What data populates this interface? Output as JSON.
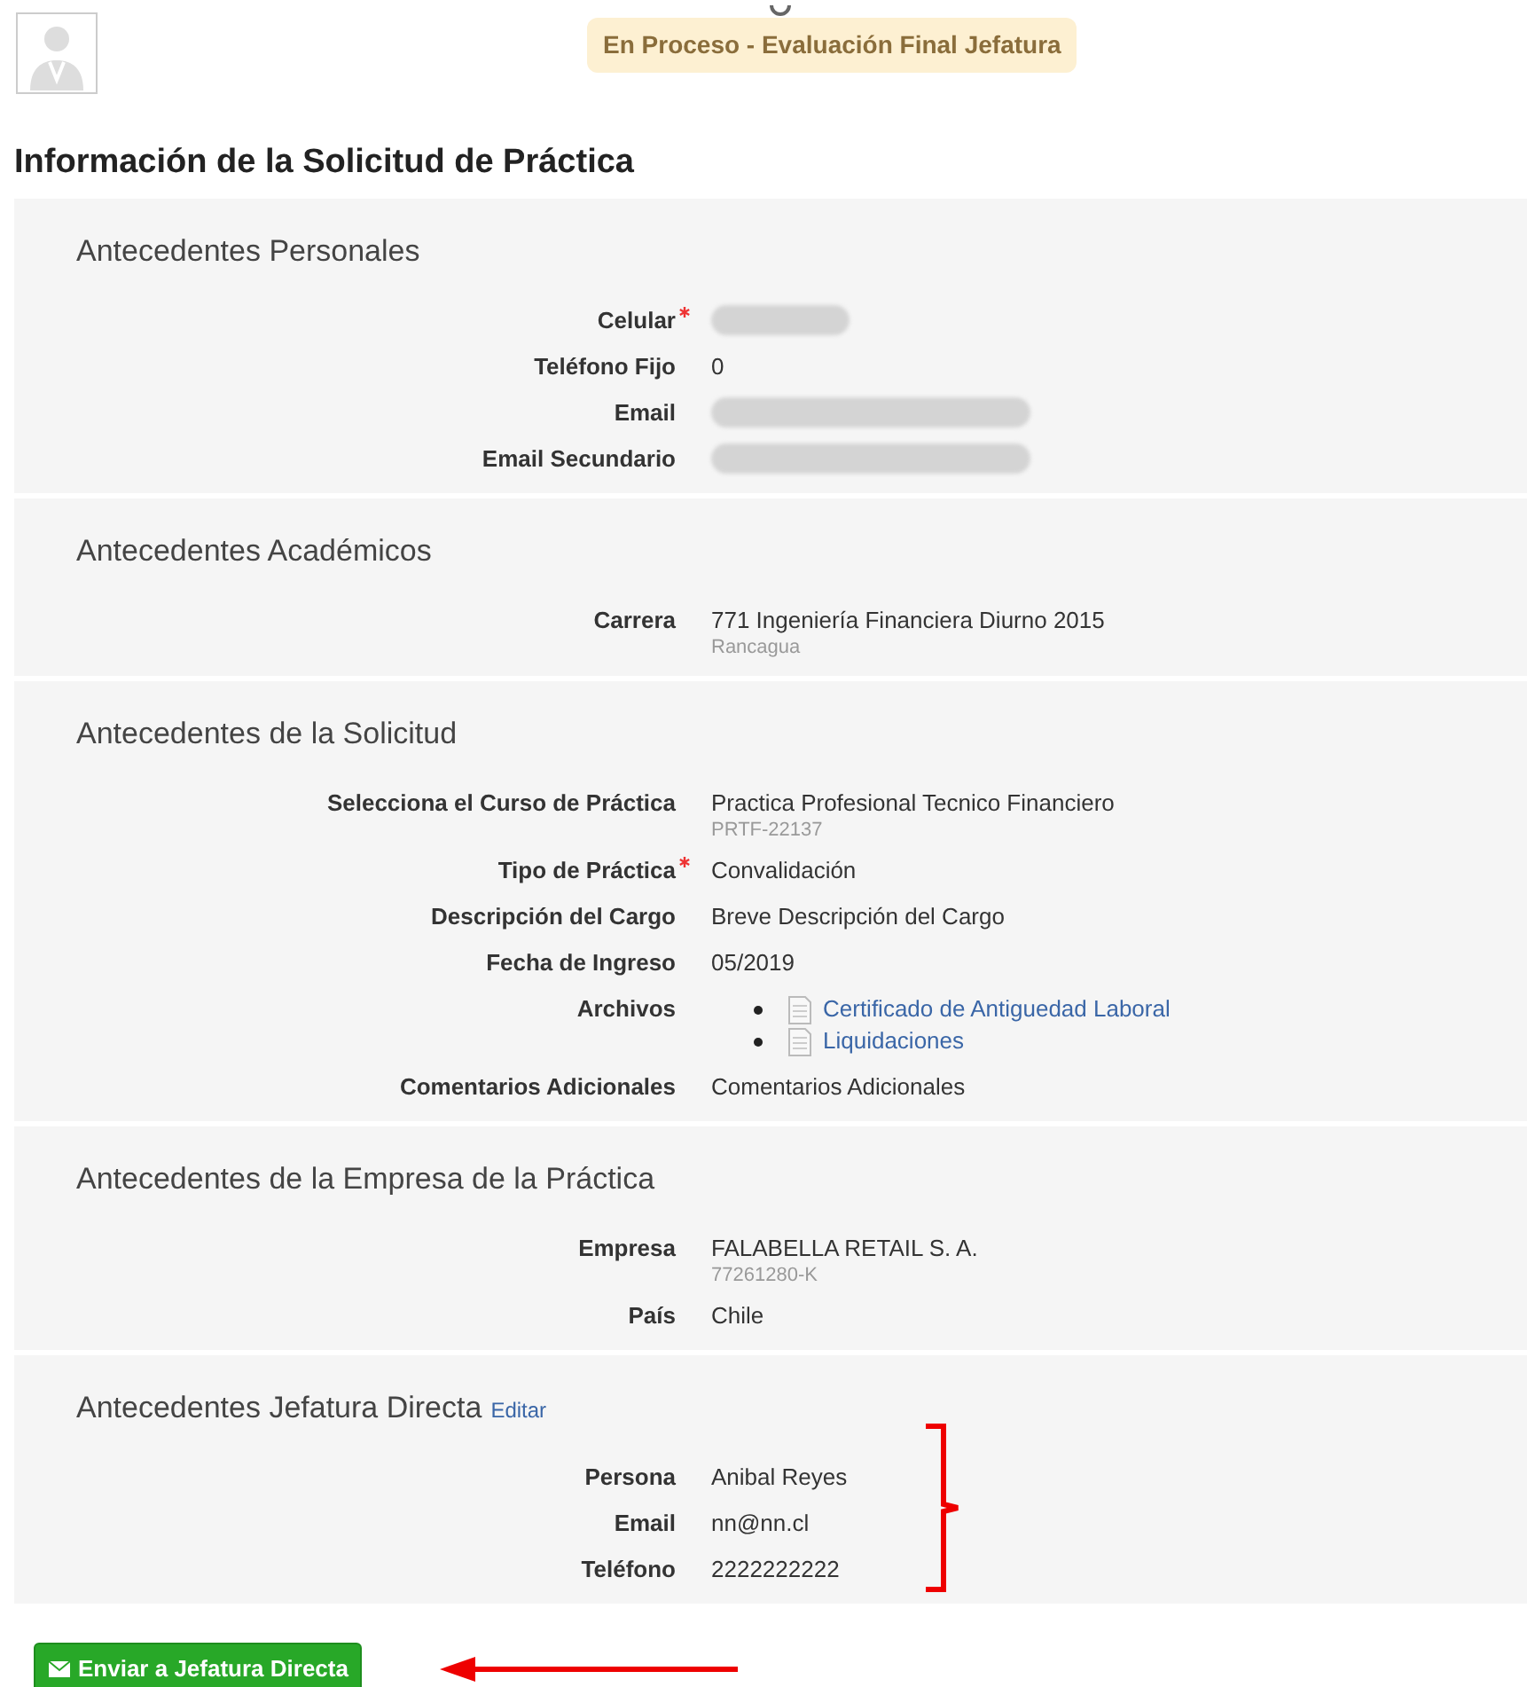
{
  "status_badge": "En Proceso - Evaluación Final Jefatura",
  "title": "Información de la Solicitud de Práctica",
  "sections": [
    {
      "title": "Antecedentes Personales",
      "fields": [
        {
          "kind": "redacted",
          "label": "Celular",
          "required": true
        },
        {
          "kind": "text",
          "label": "Teléfono Fijo",
          "required": false,
          "value": "0"
        },
        {
          "kind": "redacted",
          "label": "Email",
          "required": false
        },
        {
          "kind": "redacted",
          "label": "Email Secundario",
          "required": false
        }
      ]
    },
    {
      "title": "Antecedentes Académicos",
      "fields": [
        {
          "kind": "text",
          "label": "Carrera",
          "required": false,
          "value": "771 Ingeniería Financiera Diurno 2015",
          "sub": "Rancagua"
        }
      ]
    },
    {
      "title": "Antecedentes de la Solicitud",
      "fields": [
        {
          "kind": "text",
          "label": "Selecciona el Curso de Práctica",
          "required": false,
          "value": "Practica Profesional Tecnico Financiero",
          "sub": "PRTF-22137"
        },
        {
          "kind": "text",
          "label": "Tipo de Práctica",
          "required": true,
          "value": "Convalidación"
        },
        {
          "kind": "text",
          "label": "Descripción del Cargo",
          "required": false,
          "value": "Breve Descripción del Cargo"
        },
        {
          "kind": "text",
          "label": "Fecha de Ingreso",
          "required": false,
          "value": "05/2019"
        },
        {
          "kind": "files",
          "label": "Archivos",
          "required": false,
          "files": [
            "Certificado de Antiguedad Laboral",
            "Liquidaciones"
          ]
        },
        {
          "kind": "text",
          "label": "Comentarios Adicionales",
          "required": false,
          "value": "Comentarios Adicionales"
        }
      ]
    },
    {
      "title": "Antecedentes de la Empresa de la Práctica",
      "fields": [
        {
          "kind": "text",
          "label": "Empresa",
          "required": false,
          "value": "FALABELLA RETAIL S. A.",
          "sub": "77261280-K"
        },
        {
          "kind": "text",
          "label": "País",
          "required": false,
          "value": "Chile"
        }
      ]
    },
    {
      "title": "Antecedentes Jefatura Directa",
      "edit_link": "Editar",
      "highlighted": true,
      "fields": [
        {
          "kind": "text",
          "label": "Persona",
          "required": false,
          "value": "Anibal Reyes"
        },
        {
          "kind": "text",
          "label": "Email",
          "required": false,
          "value": "nn@nn.cl"
        },
        {
          "kind": "text",
          "label": "Teléfono",
          "required": false,
          "value": "2222222222"
        }
      ]
    }
  ],
  "submit_button": {
    "label": "Enviar a Jefatura Directa",
    "highlighted": true
  }
}
